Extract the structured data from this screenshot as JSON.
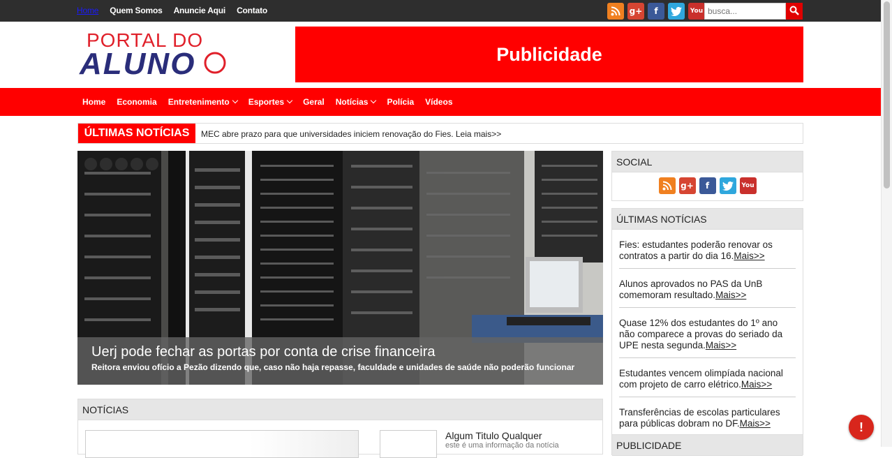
{
  "topbar": {
    "nav": [
      "Home",
      "Quem Somos",
      "Anuncie Aqui",
      "Contato"
    ],
    "search_placeholder": "busca...",
    "social_icons": [
      "rss-icon",
      "google-plus-icon",
      "facebook-icon",
      "twitter-icon",
      "youtube-icon"
    ]
  },
  "logo": {
    "line1": "PORTAL DO",
    "line2": "ALUNO"
  },
  "ad_top": {
    "label": "Publicidade"
  },
  "mainnav": {
    "items": [
      {
        "label": "Home"
      },
      {
        "label": "Economia"
      },
      {
        "label": "Entretenimento"
      },
      {
        "label": "Esportes"
      },
      {
        "label": "Geral"
      },
      {
        "label": "Notícias"
      },
      {
        "label": "Polícia"
      },
      {
        "label": "Vídeos"
      }
    ]
  },
  "ticker": {
    "label": "ÚLTIMAS NOTÍCIAS",
    "text": "MEC abre prazo para que universidades iniciem renovação do Fies. Leia mais>>"
  },
  "slider": {
    "title": "Uerj pode fechar as portas por conta de crise financeira",
    "subtitle": "Reitora enviou ofício a Pezão dizendo que, caso não haja repasse, faculdade e unidades de saúde não poderão funcionar"
  },
  "noticias": {
    "heading": "NOTÍCIAS",
    "item_title": "Algum Titulo Qualquer",
    "item_desc": "este é uma informação da notícia"
  },
  "sidebar": {
    "social_heading": "SOCIAL",
    "latest_heading": "ÚLTIMAS NOTÍCIAS",
    "latest": [
      {
        "text": "Fies: estudantes poderão renovar os contratos a partir do dia 16.",
        "more": "Mais>>"
      },
      {
        "text": "Alunos aprovados no PAS da UnB comemoram resultado.",
        "more": "Mais>>"
      },
      {
        "text": "Quase 12% dos estudantes do 1º ano não comparece a provas do seriado da UPE nesta segunda.",
        "more": "Mais>>"
      },
      {
        "text": "Estudantes vencem olimpíada nacional com projeto de carro elétrico.",
        "more": "Mais>>"
      },
      {
        "text": "Transferências de escolas particulares para públicas dobram no DF.",
        "more": "Mais>>"
      }
    ],
    "pub_heading": "PUBLICIDADE"
  },
  "colors": {
    "accent": "#ff0000",
    "topbar": "#2e2e2e",
    "link_active": "#1a1aff"
  }
}
